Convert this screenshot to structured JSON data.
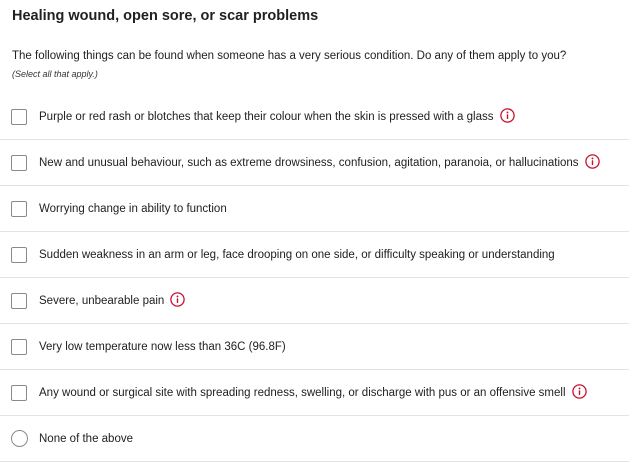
{
  "page": {
    "title": "Healing wound, open sore, or scar problems",
    "question": "The following things can be found when someone has a very serious condition. Do any of them apply to you?",
    "hint": "(Select all that apply.)"
  },
  "colors": {
    "info_icon": "#c8102e",
    "control_border": "#8a8a8a",
    "divider": "#e3e3e3"
  },
  "options": [
    {
      "label": "Purple or red rash or blotches that keep their colour when the skin is pressed with a glass",
      "type": "checkbox",
      "has_info": true,
      "checked": false
    },
    {
      "label": "New and unusual behaviour, such as extreme drowsiness, confusion, agitation, paranoia, or hallucinations",
      "type": "checkbox",
      "has_info": true,
      "checked": false
    },
    {
      "label": "Worrying change in ability to function",
      "type": "checkbox",
      "has_info": false,
      "checked": false
    },
    {
      "label": "Sudden weakness in an arm or leg, face drooping on one side, or difficulty speaking or understanding",
      "type": "checkbox",
      "has_info": false,
      "checked": false
    },
    {
      "label": "Severe, unbearable pain",
      "type": "checkbox",
      "has_info": true,
      "checked": false
    },
    {
      "label": "Very low temperature now less than 36C (96.8F)",
      "type": "checkbox",
      "has_info": false,
      "checked": false
    },
    {
      "label": "Any wound or surgical site with spreading redness, swelling, or discharge with pus or an offensive smell",
      "type": "checkbox",
      "has_info": true,
      "checked": false
    },
    {
      "label": "None of the above",
      "type": "radio",
      "has_info": false,
      "checked": false
    }
  ]
}
